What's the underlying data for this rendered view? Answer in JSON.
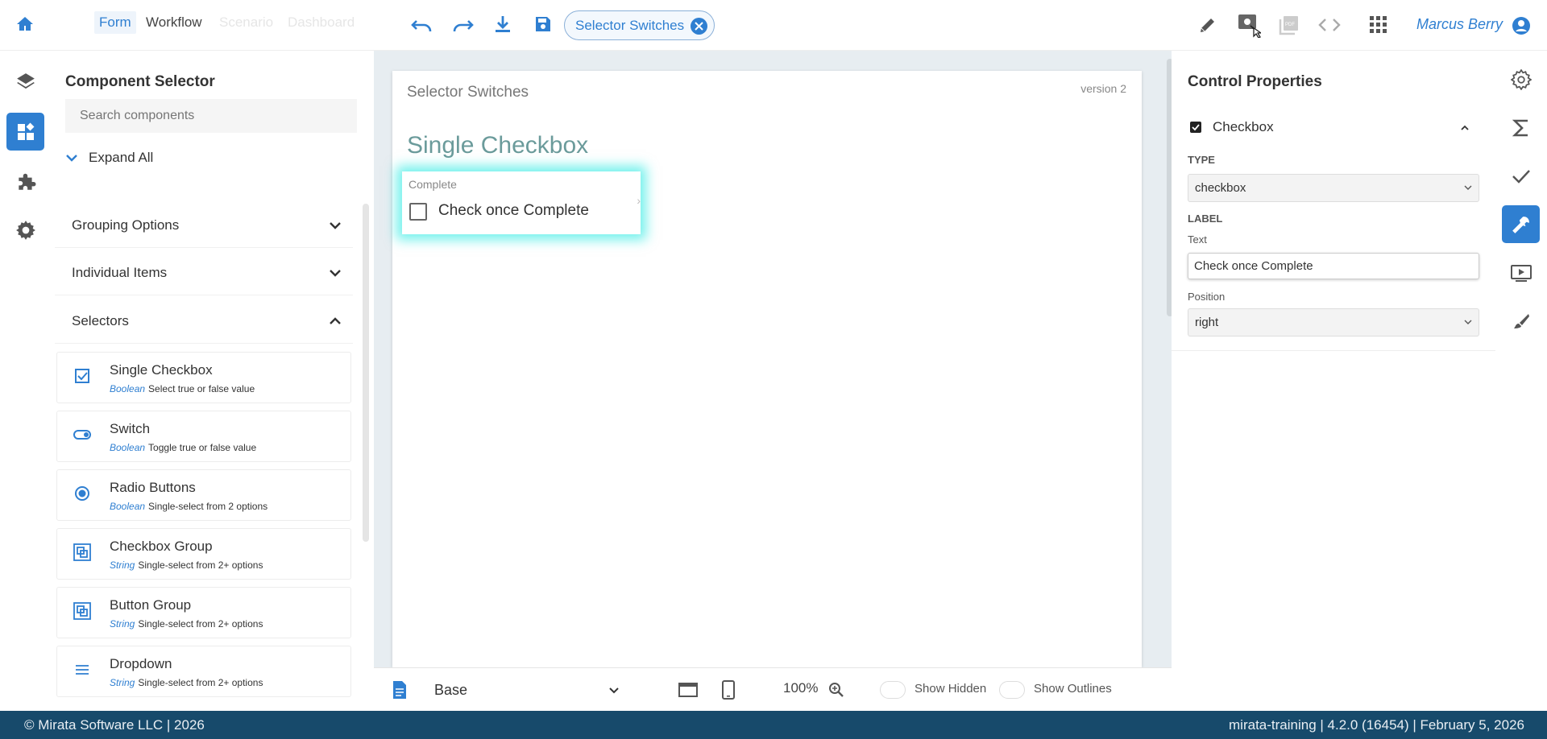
{
  "topbar": {
    "tabs": [
      {
        "label": "Form",
        "active": true
      },
      {
        "label": "Workflow",
        "active": false
      },
      {
        "label": "Scenario",
        "active": false,
        "faded": true
      },
      {
        "label": "Dashboard",
        "active": false,
        "faded": true
      }
    ],
    "toolbar_icons": [
      "undo-icon",
      "redo-icon",
      "download-icon",
      "save-icon"
    ],
    "chip_label": "Selector Switches",
    "right_icons": [
      "pencil-icon",
      "preview-icon",
      "pdf-icon",
      "code-icon",
      "apps-grid-icon"
    ],
    "user_name": "Marcus Berry"
  },
  "left_rail": [
    "home-icon",
    "layers-icon",
    "components-icon",
    "plugins-icon",
    "settings-icon"
  ],
  "selector": {
    "title": "Component Selector",
    "search_placeholder": "Search components",
    "expand_all": "Expand All",
    "groups": [
      "Grouping Options",
      "Individual Items",
      "Selectors"
    ],
    "components": [
      {
        "name": "Single Checkbox",
        "type": "Boolean",
        "desc": "Select true or false value",
        "icon": "checkbox-icon"
      },
      {
        "name": "Switch",
        "type": "Boolean",
        "desc": "Toggle true or false value",
        "icon": "switch-icon"
      },
      {
        "name": "Radio Buttons",
        "type": "Boolean",
        "desc": "Single-select from 2 options",
        "icon": "radio-icon"
      },
      {
        "name": "Checkbox Group",
        "type": "String",
        "desc": "Single-select from 2+ options",
        "icon": "checkbox-group-icon"
      },
      {
        "name": "Button Group",
        "type": "String",
        "desc": "Single-select from 2+ options",
        "icon": "button-group-icon"
      },
      {
        "name": "Dropdown",
        "type": "String",
        "desc": "Single-select from 2+ options",
        "icon": "dropdown-icon"
      }
    ]
  },
  "canvas": {
    "page_title": "Selector Switches",
    "version": "version 2",
    "section_title": "Single Checkbox",
    "control": {
      "caption": "Complete",
      "label": "Check once Complete"
    },
    "bottom": {
      "layout": "Base",
      "zoom": "100%",
      "show_hidden": "Show Hidden",
      "show_outlines": "Show Outlines"
    }
  },
  "props": {
    "title": "Control Properties",
    "group_name": "Checkbox",
    "type_label": "TYPE",
    "type_value": "checkbox",
    "label_header": "LABEL",
    "text_label": "Text",
    "text_value": "Check once Complete",
    "position_label": "Position",
    "position_value": "right"
  },
  "right_rail": [
    "gear-icon",
    "sigma-icon",
    "check-icon",
    "wrench-icon",
    "play-icon",
    "brush-icon"
  ],
  "footer": {
    "left": "© Mirata Software LLC | 2026",
    "right": "mirata-training | 4.2.0 (16454) | February 5, 2026"
  },
  "colors": {
    "accent": "#2f7fd1",
    "footer_bg": "#174a6b",
    "highlight_glow": "#00e6dc"
  }
}
